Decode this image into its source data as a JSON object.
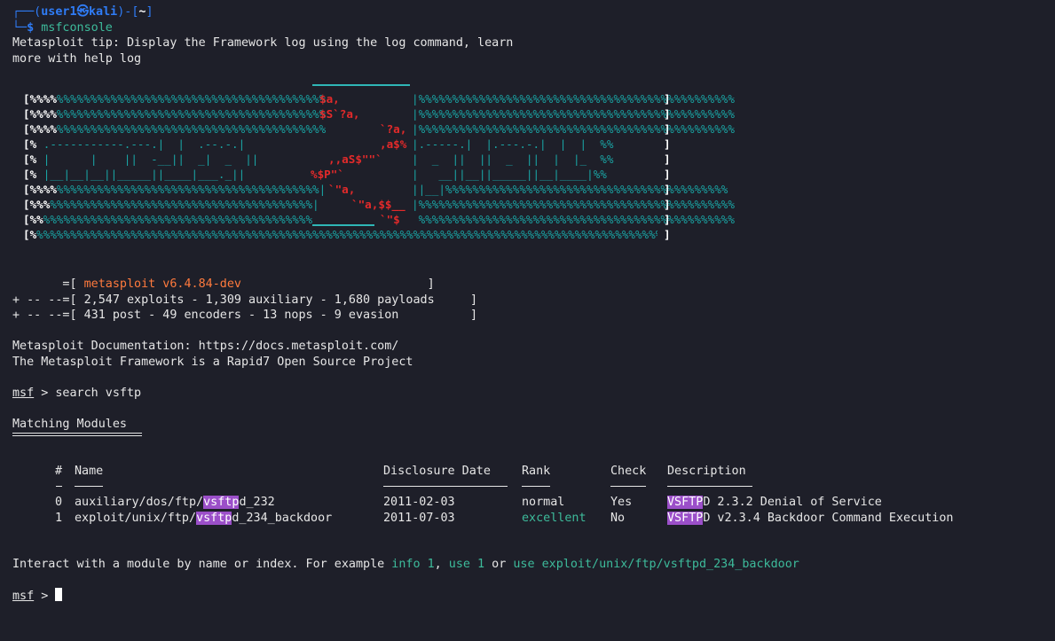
{
  "prompt": {
    "user": "user1",
    "at": "㉿",
    "host": "kali",
    "dir": "~",
    "dollar": "$",
    "command": "msfconsole"
  },
  "tip": {
    "line1": "Metasploit tip: Display the Framework log using the log command, learn",
    "line2": "more with help log"
  },
  "banner": {
    "rows": [
      {
        "k": "[%%%%",
        "t": "%%%%%%%%%%%%%%%%%%%%%%%%%%%%%%%%%%%%%%%%",
        "r": "$a,",
        "t2": "|%%%%%%%%%%%%%%%%%%%%%%%%%%%%%%%%%%%%%%%%%%%%%%%",
        "k2": "]"
      },
      {
        "k": "[%%%%",
        "t": "%%%%%%%%%%%%%%%%%%%%%%%%%%%%%%%%%%%%%%%%",
        "r": "$S`?a,",
        "t2": "|%%%%%%%%%%%%%%%%%%%%%%%%%%%%%%%%%%%%%%%%%%%%%%%",
        "k2": "]"
      },
      {
        "k": "[%%%%",
        "t": "%%%%%%%%%%%%%%%%%%%%%%%%%%%%%%%%%%%%%%%%",
        "r": "`?a,",
        "t2": "|%%%%%%%%%%%%%%%%%%%%%%%%%%%%%%%%%%%%%%%%%%%%%%%",
        "k2": "]"
      },
      {
        "k": "[%",
        "t": " .-----------.---.|  |  .--.-.|",
        "r": ",a$%",
        "t2": "|.-----.|  |.---.-.|  |  |  %%",
        "k2": "]"
      },
      {
        "k": "[%",
        "t": " |      |    ||  -__||  _|  _  ||",
        "r": ",,aS$\"\"`",
        "t2": "|  _  ||  ||  _  ||  |  |_  %%",
        "k2": "]"
      },
      {
        "k": "[%",
        "t": " |__|__|__||_____||____|___._||",
        "r": "%$P\"`",
        "t2": "|   __||__||_____||__|____|%%",
        "k2": "]"
      },
      {
        "k": "[%%%%",
        "t": "%%%%%%%%%%%%%%%%%%%%%%%%%%%%%%%%%%%%%%%|",
        "r": "`\"a,",
        "t2": "||__|%%%%%%%%%%%%%%%%%%%%%%%%%%%%%%%%%%%%%%%%%%",
        "k2": "]"
      },
      {
        "k": "[%%%",
        "t": "%%%%%%%%%%%%%%%%%%%%%%%%%%%%%%%%%%%%%%%|",
        "r": "`\"a,$$__",
        "t2": "|%%%%%%%%%%%%%%%%%%%%%%%%%%%%%%%%%%%%%%%%%%%%%%%",
        "k2": "]"
      },
      {
        "k": "[%%",
        "t": "%%%%%%%%%%%%%%%%%%%%%%%%%%%%%%%%%%%%%%%%",
        "r": "`\"$",
        "t2": " %%%%%%%%%%%%%%%%%%%%%%%%%%%%%%%%%%%%%%%%%%%%%%%",
        "k2": "]"
      },
      {
        "k": "[%",
        "t": "%%%%%%%%%%%%%%%%%%%%%%%%%%%%%%%%%%%%%%%%%%%%%%%%%%%%%%%%%%%%%%%%%%%%%%%%%%%%%%%%%%%%%%%%%%%%%%%%",
        "r": "",
        "t2": "",
        "k2": "]"
      }
    ]
  },
  "version": {
    "line1_pre": "       =[ ",
    "line1_name": "metasploit v6.4.84-dev",
    "line1_post": "                          ]",
    "line2": "+ -- --=[ 2,547 exploits - 1,309 auxiliary - 1,680 payloads     ]",
    "line3": "+ -- --=[ 431 post - 49 encoders - 13 nops - 9 evasion          ]"
  },
  "docs": {
    "line1": "Metasploit Documentation: https://docs.metasploit.com/",
    "line2": "The Metasploit Framework is a Rapid7 Open Source Project"
  },
  "search": {
    "msf": "msf",
    "prompt_tail": " > ",
    "command": "search vsftp"
  },
  "matching": {
    "title": "Matching Modules"
  },
  "table": {
    "headers": {
      "num": "#",
      "name": "Name",
      "date": "Disclosure Date",
      "rank": "Rank",
      "check": "Check",
      "desc": "Description"
    },
    "rows": [
      {
        "num": "0",
        "name_pre": "auxiliary/dos/ftp/",
        "name_hl": "vsftp",
        "name_post": "d_232",
        "date": "2011-02-03",
        "rank": "normal",
        "check": "Yes",
        "desc_hl": "VSFTP",
        "desc_post": "D 2.3.2 Denial of Service"
      },
      {
        "num": "1",
        "name_pre": "exploit/unix/ftp/",
        "name_hl": "vsftp",
        "name_post": "d_234_backdoor",
        "date": "2011-07-03",
        "rank": "excellent",
        "check": "No",
        "desc_hl": "VSFTP",
        "desc_post": "D v2.3.4 Backdoor Command Execution"
      }
    ]
  },
  "interact": {
    "pre": "Interact with a module by name or index. For example ",
    "info": "info 1",
    "comma": ", ",
    "use1": "use 1",
    "or": " or ",
    "use_full": "use exploit/unix/ftp/vsftpd_234_backdoor"
  },
  "final_prompt": {
    "msf": "msf",
    "tail": " > "
  },
  "colors": {
    "background": "#1e1f29",
    "prompt_blue": "#2f7cf6",
    "red": "#e42a2a",
    "teal": "#2fb6b6",
    "highlight": "#9b4fc9",
    "excellent_green": "#3dbb9b"
  }
}
